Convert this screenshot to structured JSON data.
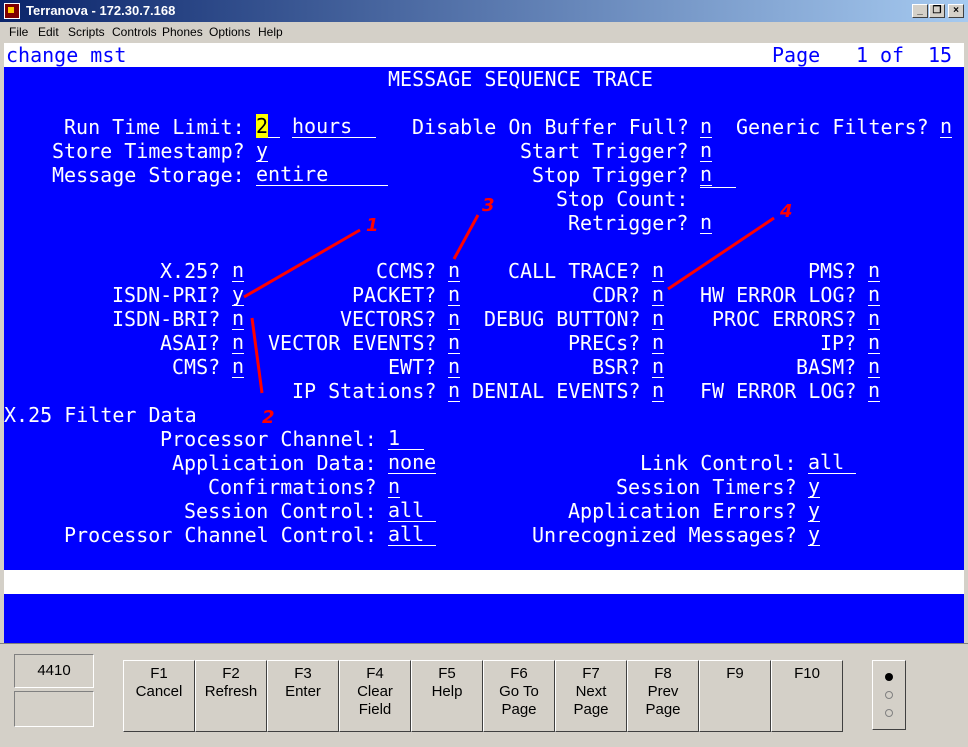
{
  "window": {
    "title": "Terranova - 172.30.7.168"
  },
  "menu": [
    "File",
    "Edit",
    "Scripts",
    "Controls",
    "Phones",
    "Options",
    "Help"
  ],
  "header": {
    "command": "change mst",
    "page_label": "Page",
    "page_current": "1",
    "page_of": "of",
    "page_total": "15"
  },
  "screen": {
    "title": "MESSAGE SEQUENCE TRACE",
    "run_time_limit": {
      "label": "Run Time Limit:",
      "value": "2",
      "unit": "hours"
    },
    "store_timestamp": {
      "label": "Store Timestamp?",
      "value": "y"
    },
    "message_storage": {
      "label": "Message Storage:",
      "value": "entire"
    },
    "disable_on_buffer_full": {
      "label": "Disable On Buffer Full?",
      "value": "n"
    },
    "generic_filters": {
      "label": "Generic Filters?",
      "value": "n"
    },
    "start_trigger": {
      "label": "Start Trigger?",
      "value": "n"
    },
    "stop_trigger": {
      "label": "Stop Trigger?",
      "value": "n"
    },
    "stop_count": {
      "label": "Stop Count:",
      "value": ""
    },
    "retrigger": {
      "label": "Retrigger?",
      "value": "n"
    },
    "filters": {
      "x25": {
        "label": "X.25?",
        "value": "n"
      },
      "isdn_pri": {
        "label": "ISDN-PRI?",
        "value": "y"
      },
      "isdn_bri": {
        "label": "ISDN-BRI?",
        "value": "n"
      },
      "asai": {
        "label": "ASAI?",
        "value": "n"
      },
      "cms": {
        "label": "CMS?",
        "value": "n"
      },
      "ccms": {
        "label": "CCMS?",
        "value": "n"
      },
      "packet": {
        "label": "PACKET?",
        "value": "n"
      },
      "vectors": {
        "label": "VECTORS?",
        "value": "n"
      },
      "vector_events": {
        "label": "VECTOR EVENTS?",
        "value": "n"
      },
      "ewt": {
        "label": "EWT?",
        "value": "n"
      },
      "ip_stations": {
        "label": "IP Stations?",
        "value": "n"
      },
      "call_trace": {
        "label": "CALL TRACE?",
        "value": "n"
      },
      "cdr": {
        "label": "CDR?",
        "value": "n"
      },
      "debug_button": {
        "label": "DEBUG BUTTON?",
        "value": "n"
      },
      "precs": {
        "label": "PRECs?",
        "value": "n"
      },
      "bsr": {
        "label": "BSR?",
        "value": "n"
      },
      "denial_events": {
        "label": "DENIAL EVENTS?",
        "value": "n"
      },
      "pms": {
        "label": "PMS?",
        "value": "n"
      },
      "hw_error_log": {
        "label": "HW ERROR LOG?",
        "value": "n"
      },
      "proc_errors": {
        "label": "PROC ERRORS?",
        "value": "n"
      },
      "ip": {
        "label": "IP?",
        "value": "n"
      },
      "basm": {
        "label": "BASM?",
        "value": "n"
      },
      "fw_error_log": {
        "label": "FW ERROR LOG?",
        "value": "n"
      }
    },
    "x25_filter": {
      "heading": "X.25 Filter Data",
      "processor_channel": {
        "label": "Processor Channel:",
        "value": "1"
      },
      "application_data": {
        "label": "Application Data:",
        "value": "none"
      },
      "confirmations": {
        "label": "Confirmations?",
        "value": "n"
      },
      "session_control": {
        "label": "Session Control:",
        "value": "all"
      },
      "processor_channel_control": {
        "label": "Processor Channel Control:",
        "value": "all"
      },
      "link_control": {
        "label": "Link Control:",
        "value": "all"
      },
      "session_timers": {
        "label": "Session Timers?",
        "value": "y"
      },
      "application_errors": {
        "label": "Application Errors?",
        "value": "y"
      },
      "unrecognized_messages": {
        "label": "Unrecognized Messages?",
        "value": "y"
      }
    }
  },
  "annotations": {
    "color": "#ff0000",
    "labels": [
      "1",
      "2",
      "3",
      "4"
    ]
  },
  "station": {
    "extension": "4410",
    "secondary": ""
  },
  "function_keys": [
    {
      "key": "F1",
      "line1": "Cancel",
      "line2": ""
    },
    {
      "key": "F2",
      "line1": "Refresh",
      "line2": ""
    },
    {
      "key": "F3",
      "line1": "Enter",
      "line2": ""
    },
    {
      "key": "F4",
      "line1": "Clear",
      "line2": "Field"
    },
    {
      "key": "F5",
      "line1": "Help",
      "line2": ""
    },
    {
      "key": "F6",
      "line1": "Go To",
      "line2": "Page"
    },
    {
      "key": "F7",
      "line1": "Next",
      "line2": "Page"
    },
    {
      "key": "F8",
      "line1": "Prev",
      "line2": "Page"
    },
    {
      "key": "F9",
      "line1": "",
      "line2": ""
    },
    {
      "key": "F10",
      "line1": "",
      "line2": ""
    }
  ],
  "colors": {
    "screen_bg": "#0000ff",
    "text": "#ffffff",
    "highlight": "#ffff00",
    "annotation": "#ff0000"
  }
}
